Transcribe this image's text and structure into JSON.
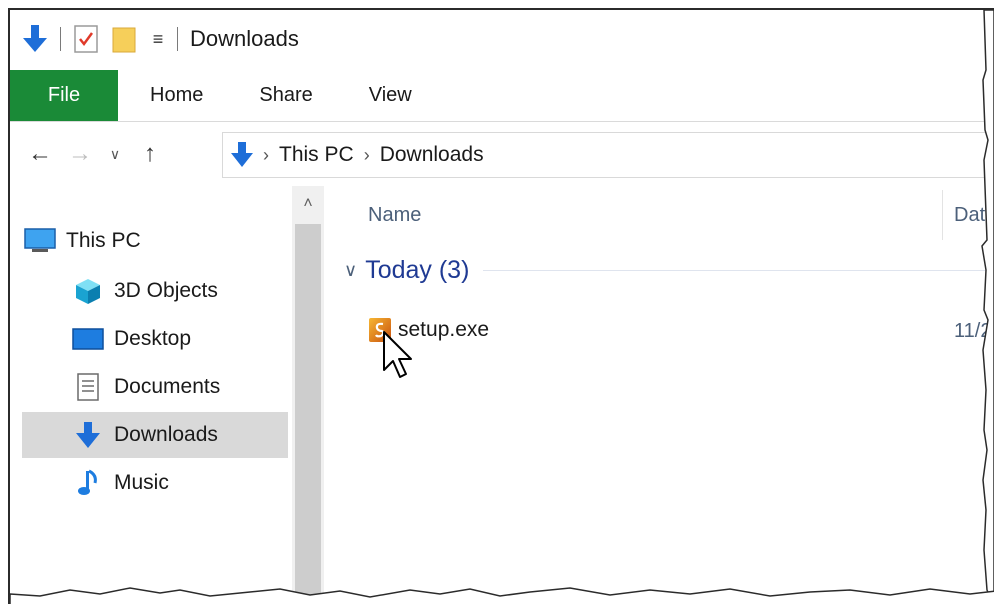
{
  "window": {
    "title": "Downloads",
    "quick_access_dropdown": "≡"
  },
  "ribbon": {
    "tabs": [
      {
        "label": "File"
      },
      {
        "label": "Home"
      },
      {
        "label": "Share"
      },
      {
        "label": "View"
      }
    ]
  },
  "address": {
    "back": "←",
    "forward": "→",
    "recent": "∨",
    "up": "↑",
    "separator": "›",
    "crumbs": [
      "This PC",
      "Downloads"
    ]
  },
  "nav": {
    "items": [
      {
        "label": "This PC",
        "icon": "computer-icon"
      },
      {
        "label": "3D Objects",
        "icon": "cube-icon"
      },
      {
        "label": "Desktop",
        "icon": "desktop-icon"
      },
      {
        "label": "Documents",
        "icon": "document-icon"
      },
      {
        "label": "Downloads",
        "icon": "download-arrow-icon",
        "selected": true
      },
      {
        "label": "Music",
        "icon": "music-note-icon"
      }
    ],
    "scroll_up": "˄"
  },
  "content": {
    "columns": [
      "Name",
      "Dat"
    ],
    "group": {
      "chevron": "∨",
      "label": "Today (3)"
    },
    "files": [
      {
        "name": "setup.exe",
        "date": "11/2"
      }
    ]
  },
  "colors": {
    "file_tab": "#1a8a37",
    "accent_blue": "#1e6ed8",
    "selected_bg": "#d9d9d9",
    "group_label": "#1f3a93"
  }
}
